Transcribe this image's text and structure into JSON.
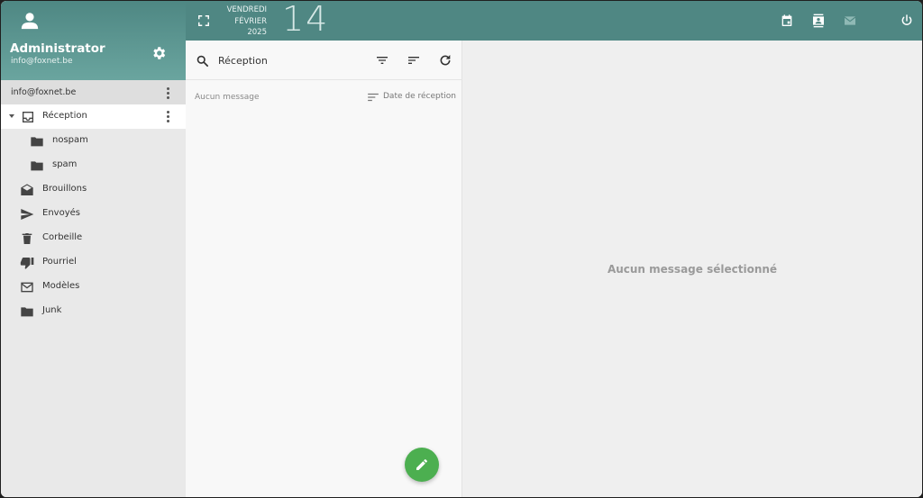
{
  "user": {
    "name": "Administrator",
    "email": "info@foxnet.be"
  },
  "account": {
    "label": "info@foxnet.be"
  },
  "folders": [
    {
      "label": "Réception",
      "icon": "inbox-icon"
    },
    {
      "label": "nospam",
      "icon": "folder-icon"
    },
    {
      "label": "spam",
      "icon": "folder-icon"
    },
    {
      "label": "Brouillons",
      "icon": "drafts-icon"
    },
    {
      "label": "Envoyés",
      "icon": "send-icon"
    },
    {
      "label": "Corbeille",
      "icon": "trash-icon"
    },
    {
      "label": "Pourriel",
      "icon": "thumb-down-icon"
    },
    {
      "label": "Modèles",
      "icon": "mail-outline-icon"
    },
    {
      "label": "Junk",
      "icon": "folder-icon"
    }
  ],
  "topbar": {
    "weekday": "VENDREDI",
    "month": "FÉVRIER",
    "year": "2025",
    "day": "14"
  },
  "list": {
    "title": "Réception",
    "empty_label": "Aucun message",
    "sort_label": "Date de réception"
  },
  "reading_pane": {
    "empty_label": "Aucun message sélectionné"
  },
  "colors": {
    "header_teal": "#4f8783",
    "compose_green": "#4caf50",
    "active_folder_bg": "#ffffff"
  }
}
